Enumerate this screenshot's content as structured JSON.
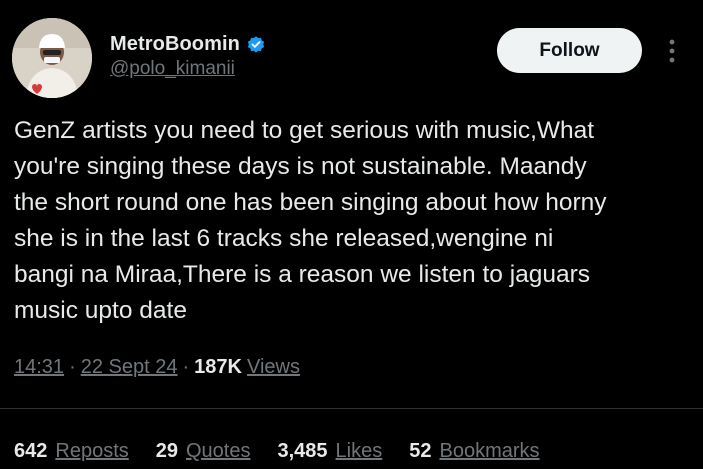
{
  "tweet": {
    "author": {
      "display_name": "MetroBoomin",
      "handle": "@polo_kimanii",
      "verified_icon": "verified-badge-icon",
      "verified_color": "#1d9bf0"
    },
    "follow_label": "Follow",
    "more_icon": "more-vertical-icon",
    "text": "GenZ artists you need to get serious with music,What\nyou're singing these days is not sustainable. Maandy\nthe short round one has been singing about how horny\nshe is in the last 6 tracks she released,wengine ni\nbangi na Miraa,There is a reason we listen to jaguars\nmusic upto date",
    "meta": {
      "time": "14:31",
      "date": "22 Sept 24",
      "views_count": "187K",
      "views_label": "Views",
      "separator": "·"
    },
    "stats": {
      "reposts_count": "642",
      "reposts_label": "Reposts",
      "quotes_count": "29",
      "quotes_label": "Quotes",
      "likes_count": "3,485",
      "likes_label": "Likes",
      "bookmarks_count": "52",
      "bookmarks_label": "Bookmarks"
    }
  },
  "colors": {
    "background": "#000000",
    "primary_text": "#e7e9ea",
    "secondary_text": "#71767b",
    "divider": "#2f3336",
    "follow_bg": "#eff3f4"
  }
}
